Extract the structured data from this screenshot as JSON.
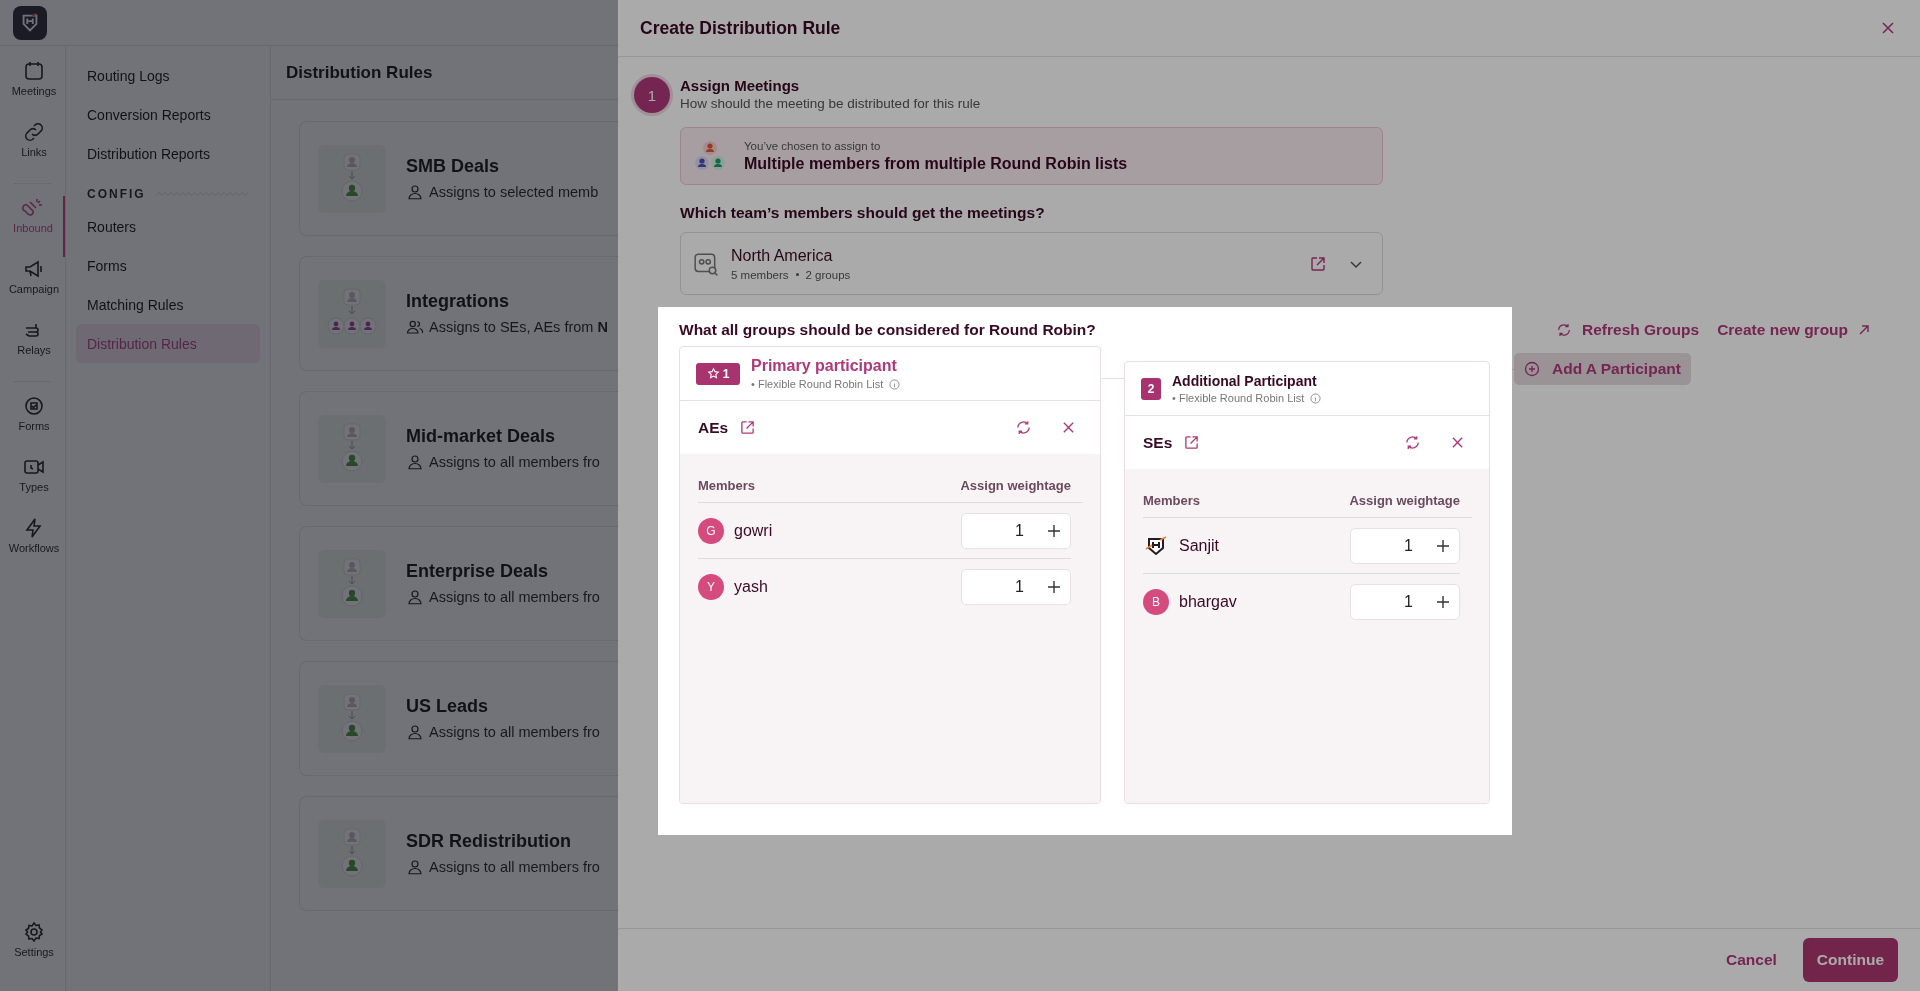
{
  "app": {
    "rail": [
      {
        "label": "Meetings",
        "selected": false
      },
      {
        "label": "Links",
        "selected": false
      },
      {
        "label": "Inbound",
        "selected": true
      },
      {
        "label": "Campaign",
        "selected": false
      },
      {
        "label": "Relays",
        "selected": false
      },
      {
        "label": "Forms",
        "selected": false
      },
      {
        "label": "Types",
        "selected": false
      },
      {
        "label": "Workflows",
        "selected": false
      }
    ],
    "settings": "Settings",
    "nav_top": [
      {
        "label": "Routing Logs",
        "selected": false
      },
      {
        "label": "Conversion Reports",
        "selected": false
      },
      {
        "label": "Distribution Reports",
        "selected": false
      }
    ],
    "config_heading": "CONFIG",
    "nav_config": [
      {
        "label": "Routers",
        "selected": false
      },
      {
        "label": "Forms",
        "selected": false
      },
      {
        "label": "Matching Rules",
        "selected": false
      },
      {
        "label": "Distribution Rules",
        "selected": true
      }
    ],
    "page_title": "Distribution Rules",
    "rules": [
      {
        "name": "SMB Deals",
        "kind": "single",
        "description": "Assigns to selected memb"
      },
      {
        "name": "Integrations",
        "kind": "multi",
        "description": "Assigns to SEs, AEs from **N**"
      },
      {
        "name": "Mid-market Deals",
        "kind": "single",
        "description": "Assigns to all members fro"
      },
      {
        "name": "Enterprise Deals",
        "kind": "single",
        "description": "Assigns to all members fro"
      },
      {
        "name": "US Leads",
        "kind": "single",
        "description": "Assigns to all members fro"
      },
      {
        "name": "SDR Redistribution",
        "kind": "single",
        "description": "Assigns to all members fro"
      }
    ]
  },
  "drawer": {
    "title": "Create Distribution Rule",
    "step": {
      "number": "1",
      "title": "Assign Meetings",
      "subtitle": "How should the meeting be distributed for this rule"
    },
    "chosen": {
      "caption": "You’ve chosen to assign to",
      "value": "Multiple members from multiple Round Robin lists"
    },
    "team_question": "Which team’s members should get the meetings?",
    "team": {
      "name": "North America",
      "members": "5 members",
      "groups": "2 groups"
    },
    "groups_question": "What all groups should be considered for Round Robin?",
    "refresh": "Refresh Groups",
    "create": "Create new group",
    "add_participant": "Add A Participant",
    "participants": [
      {
        "kind": "primary",
        "badge": "1",
        "title": "Primary participant",
        "list_type": "• Flexible Round Robin List",
        "group": "AEs",
        "col_members": "Members",
        "col_weight": "Assign weightage",
        "members": [
          {
            "name": "gowri",
            "kind": "initial",
            "initial": "G",
            "weight": "1"
          },
          {
            "name": "yash",
            "kind": "initial",
            "initial": "Y",
            "weight": "1"
          }
        ]
      },
      {
        "kind": "additional",
        "badge": "2",
        "title": "Additional Participant",
        "list_type": "• Flexible Round Robin List",
        "group": "SEs",
        "col_members": "Members",
        "col_weight": "Assign weightage",
        "members": [
          {
            "name": "Sanjit",
            "kind": "logo",
            "weight": "1"
          },
          {
            "name": "bhargav",
            "kind": "initial",
            "initial": "B",
            "weight": "1"
          }
        ]
      }
    ],
    "cancel": "Cancel",
    "continue": "Continue"
  }
}
